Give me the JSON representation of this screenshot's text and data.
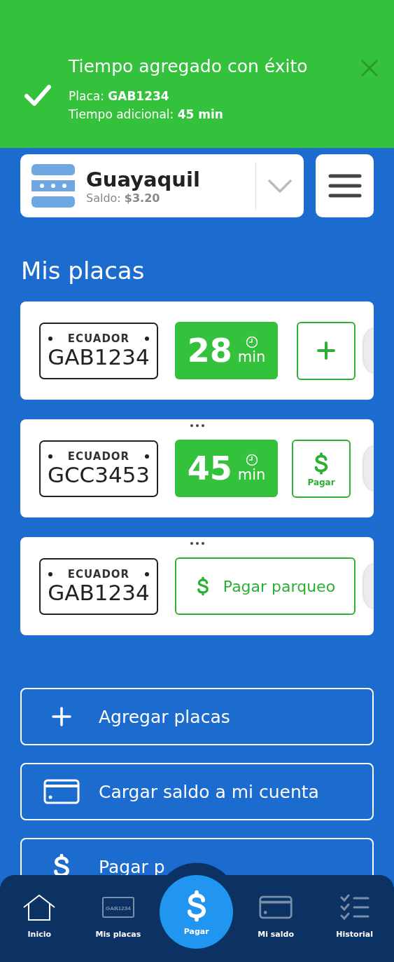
{
  "toast": {
    "title": "Tiempo agregado con éxito",
    "lines": [
      {
        "label": "Placa:",
        "value": "GAB1234"
      },
      {
        "label": "Tiempo adicional:",
        "value": "45 min"
      }
    ]
  },
  "city": {
    "name": "Guayaquil",
    "balance_label": "Saldo:",
    "balance": "$3.20"
  },
  "section_title": "Mis placas",
  "plates": [
    {
      "country": "ECUADOR",
      "plate": "GAB1234",
      "minutes": "28",
      "unit": "min",
      "kind": "add_time"
    },
    {
      "country": "ECUADOR",
      "plate": "GCC3453",
      "minutes": "45",
      "unit": "min",
      "kind": "pay_small",
      "action_label": "Pagar"
    },
    {
      "country": "ECUADOR",
      "plate": "GAB1234",
      "kind": "pay_parking",
      "action_label": "Pagar parqueo"
    }
  ],
  "actions": [
    {
      "kind": "plus",
      "label": "Agregar placas"
    },
    {
      "kind": "card",
      "label": "Cargar saldo a mi cuenta"
    },
    {
      "kind": "dollar",
      "label": "Pagar p"
    }
  ],
  "nav": [
    {
      "kind": "home",
      "label": "Inicio",
      "selected": true
    },
    {
      "kind": "plate",
      "label": "Mis placas",
      "icon_text": "GAB1234",
      "selected": false
    },
    {
      "kind": "center",
      "label": "Pagar",
      "selected": false
    },
    {
      "kind": "card",
      "label": "Mi saldo",
      "selected": false
    },
    {
      "kind": "list",
      "label": "Historial",
      "selected": false
    }
  ]
}
